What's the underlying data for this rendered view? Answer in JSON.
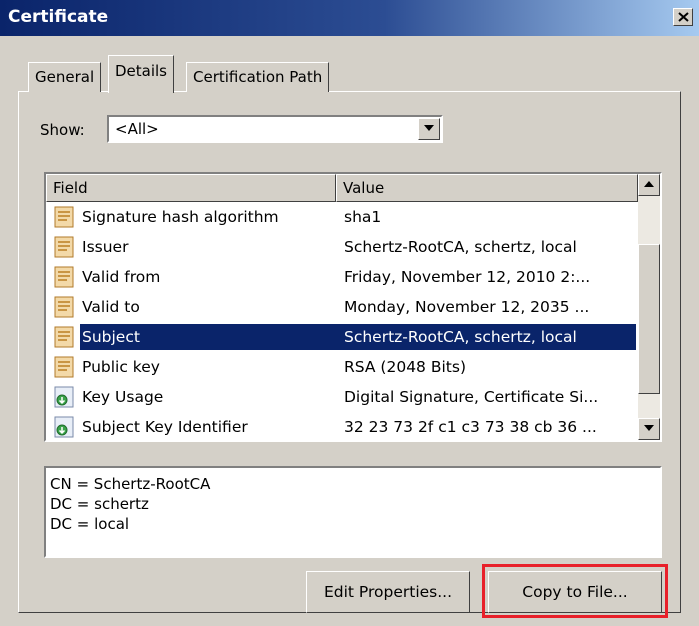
{
  "window": {
    "title": "Certificate"
  },
  "tabs": [
    {
      "label": "General"
    },
    {
      "label": "Details"
    },
    {
      "label": "Certification Path"
    }
  ],
  "show": {
    "label": "Show:",
    "selected": "<All>"
  },
  "list": {
    "columns": [
      "Field",
      "Value"
    ],
    "rows": [
      {
        "field": "Signature hash algorithm",
        "value": "sha1",
        "icon": "document-field-icon"
      },
      {
        "field": "Issuer",
        "value": "Schertz-RootCA, schertz, local",
        "icon": "document-field-icon"
      },
      {
        "field": "Valid from",
        "value": "Friday, November 12, 2010 2:...",
        "icon": "document-field-icon"
      },
      {
        "field": "Valid to",
        "value": "Monday, November 12, 2035 ...",
        "icon": "document-field-icon"
      },
      {
        "field": "Subject",
        "value": "Schertz-RootCA, schertz, local",
        "icon": "document-field-icon",
        "selected": true
      },
      {
        "field": "Public key",
        "value": "RSA (2048 Bits)",
        "icon": "document-field-icon"
      },
      {
        "field": "Key Usage",
        "value": "Digital Signature, Certificate Si...",
        "icon": "extension-field-icon"
      },
      {
        "field": "Subject Key Identifier",
        "value": "32 23 73 2f c1 c3 73 38 cb 36 ...",
        "icon": "extension-field-icon"
      }
    ]
  },
  "detail_lines": [
    "CN = Schertz-RootCA",
    "DC = schertz",
    "DC = local"
  ],
  "buttons": {
    "edit": "Edit Properties...",
    "copy": "Copy to File..."
  },
  "colors": {
    "selection": "#0a246a",
    "highlight_border": "#e8202a",
    "dialog_face": "#d4d0c8"
  }
}
